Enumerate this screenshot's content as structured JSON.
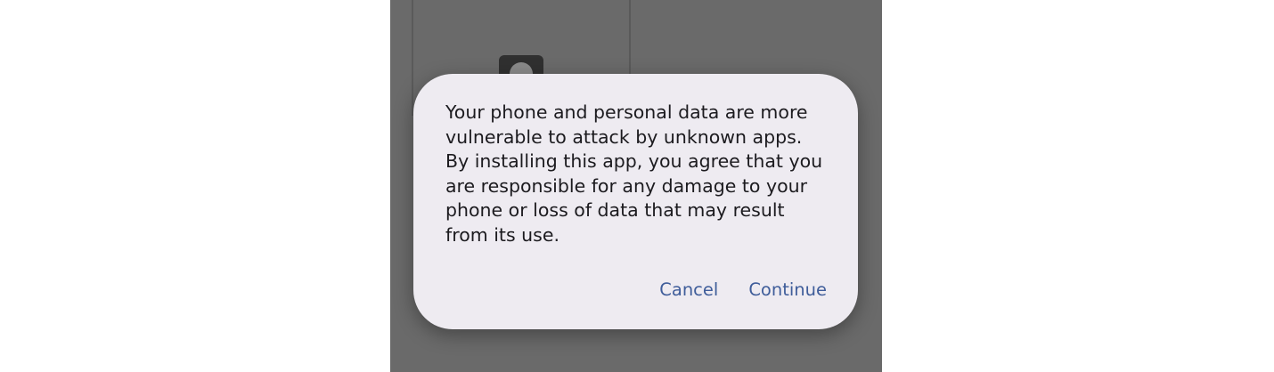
{
  "dialog": {
    "message": "Your phone and personal data are more vulnerable to attack by unknown apps. By installing this app, you agree that you are responsible for any damage to your phone or loss of data that may result from its use.",
    "cancel_label": "Cancel",
    "continue_label": "Continue"
  },
  "colors": {
    "scrim": "#6a6a6a",
    "dialog_background": "#eeebf1",
    "text": "#1c1b1f",
    "accent": "#3f5d9a"
  },
  "icons": {
    "background_app_icon": "android-icon"
  }
}
